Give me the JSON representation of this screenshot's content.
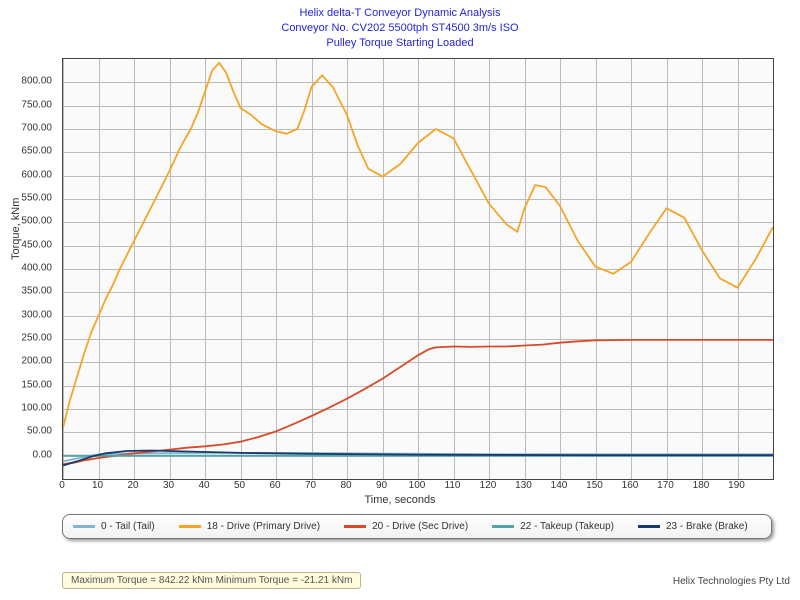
{
  "title_lines": [
    "Helix delta-T Conveyor Dynamic Analysis",
    "Conveyor No. CV202 5500tph ST4500 3m/s ISO",
    "Pulley Torque Starting Loaded"
  ],
  "xlabel": "Time, seconds",
  "ylabel": "Torque, kNm",
  "summary": "Maximum Torque = 842.22 kNm Minimum Torque = -21.21 kNm",
  "branding": "Helix Technologies Pty Ltd",
  "legend": [
    {
      "color": "#7fb5d1",
      "label": "0 - Tail (Tail)"
    },
    {
      "color": "#f5a429",
      "label": "18 - Drive (Primary Drive)"
    },
    {
      "color": "#d94a2a",
      "label": "20 - Drive (Sec Drive)"
    },
    {
      "color": "#4fa6a5",
      "label": "22 - Takeup (Takeup)"
    },
    {
      "color": "#1b3a6b",
      "label": "23 - Brake (Brake)"
    }
  ],
  "chart_data": {
    "type": "line",
    "xlabel": "Time, seconds",
    "ylabel": "Torque, kNm",
    "title": "Pulley Torque Starting Loaded",
    "xlim": [
      0,
      200
    ],
    "ylim": [
      -50,
      850
    ],
    "xticks": [
      0,
      10,
      20,
      30,
      40,
      50,
      60,
      70,
      80,
      90,
      100,
      110,
      120,
      130,
      140,
      150,
      160,
      170,
      180,
      190
    ],
    "yticks": [
      0,
      50,
      100,
      150,
      200,
      250,
      300,
      350,
      400,
      450,
      500,
      550,
      600,
      650,
      700,
      750,
      800
    ],
    "series": [
      {
        "name": "0 - Tail (Tail)",
        "color": "#7fb5d1",
        "x": [
          0,
          10,
          20,
          40,
          60,
          80,
          100,
          120,
          140,
          160,
          180,
          200
        ],
        "y": [
          -12,
          3,
          5,
          6,
          6,
          5,
          4,
          3,
          3,
          3,
          3,
          3
        ]
      },
      {
        "name": "18 - Drive (Primary Drive)",
        "color": "#f5a429",
        "x": [
          0,
          2,
          4,
          6,
          8,
          10,
          12,
          14,
          16,
          18,
          20,
          22,
          25,
          28,
          30,
          33,
          36,
          38,
          40,
          42,
          44,
          46,
          48,
          50,
          53,
          56,
          60,
          63,
          66,
          68,
          70,
          73,
          76,
          80,
          83,
          86,
          90,
          95,
          100,
          105,
          110,
          115,
          120,
          125,
          128,
          130,
          133,
          136,
          140,
          145,
          150,
          155,
          160,
          165,
          170,
          175,
          180,
          185,
          190,
          195,
          200
        ],
        "y": [
          60,
          120,
          170,
          220,
          265,
          300,
          335,
          365,
          400,
          430,
          460,
          490,
          535,
          580,
          610,
          660,
          700,
          735,
          780,
          825,
          842,
          820,
          780,
          745,
          730,
          710,
          695,
          690,
          700,
          740,
          790,
          815,
          790,
          730,
          665,
          615,
          598,
          625,
          670,
          700,
          680,
          610,
          540,
          495,
          480,
          530,
          580,
          575,
          535,
          460,
          405,
          390,
          415,
          475,
          530,
          510,
          440,
          380,
          360,
          420,
          490
        ]
      },
      {
        "name": "20 - Drive (Sec Drive)",
        "color": "#d94a2a",
        "x": [
          0,
          3,
          6,
          10,
          15,
          20,
          25,
          30,
          35,
          40,
          45,
          50,
          55,
          60,
          65,
          70,
          75,
          80,
          85,
          90,
          95,
          100,
          103,
          105,
          110,
          115,
          120,
          125,
          130,
          135,
          140,
          145,
          150,
          160,
          170,
          180,
          190,
          200
        ],
        "y": [
          -18,
          -15,
          -10,
          -5,
          0,
          5,
          9,
          13,
          17,
          20,
          24,
          30,
          40,
          52,
          68,
          85,
          103,
          122,
          143,
          165,
          190,
          215,
          228,
          232,
          234,
          233,
          234,
          234,
          236,
          238,
          242,
          245,
          247,
          248,
          248,
          248,
          248,
          248
        ]
      },
      {
        "name": "22 - Takeup (Takeup)",
        "color": "#4fa6a5",
        "x": [
          0,
          50,
          100,
          150,
          200
        ],
        "y": [
          0,
          0,
          0,
          0,
          0
        ]
      },
      {
        "name": "23 - Brake (Brake)",
        "color": "#1b3a6b",
        "x": [
          0,
          4,
          8,
          12,
          18,
          25,
          35,
          50,
          70,
          100,
          150,
          200
        ],
        "y": [
          -21,
          -12,
          -2,
          5,
          10,
          11,
          9,
          6,
          4,
          2,
          1,
          1
        ]
      }
    ]
  }
}
